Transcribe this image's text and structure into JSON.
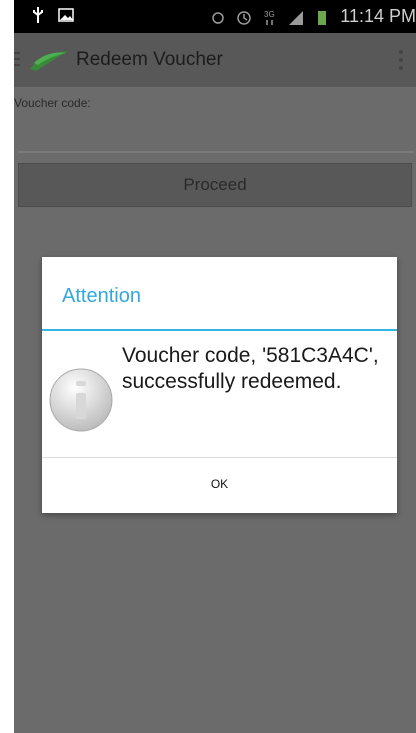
{
  "status_bar": {
    "time": "11:14 PM",
    "icons": [
      "usb-icon",
      "image-icon",
      "vibrate-icon",
      "alarm-icon",
      "3g-icon",
      "signal-icon",
      "battery-icon"
    ]
  },
  "action_bar": {
    "title": "Redeem Voucher",
    "icons": [
      "menu-icon",
      "app-logo-icon",
      "overflow-icon"
    ]
  },
  "form": {
    "voucher_label": "Voucher code:",
    "voucher_value": "",
    "proceed_label": "Proceed"
  },
  "dialog": {
    "title": "Attention",
    "message": "Voucher code, '581C3A4C', successfully redeemed.",
    "ok_label": "OK",
    "icon": "info-icon"
  },
  "colors": {
    "accent": "#33b5e5",
    "title_blue": "#33a8dd"
  }
}
